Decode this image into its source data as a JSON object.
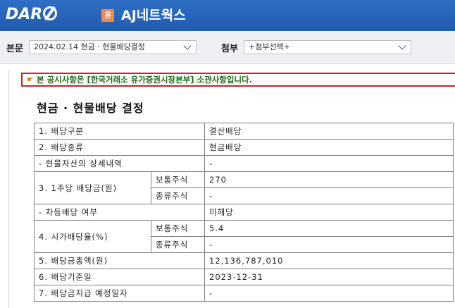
{
  "header": {
    "logo": "DART",
    "badge": "유",
    "company": "AJ네트웍스"
  },
  "toolbar": {
    "main_label": "본문",
    "main_select": "2024.02.14  현금 · 현물배당결정",
    "attach_label": "첨부",
    "attach_select": "+첨부선택+"
  },
  "notice": "본 공시사항은 [한국거래소 유가증권시장본부] 소관사항입니다.",
  "doc_title": "현금 · 현물배당 결정",
  "rows": [
    {
      "label": "1. 배당구분",
      "value": "결산배당"
    },
    {
      "label": "2. 배당종류",
      "value": "현금배당"
    },
    {
      "label": "- 현물자산의 상세내역",
      "value": "-"
    },
    {
      "label": "3. 1주당 배당금(원)",
      "sub1": "보통주식",
      "val1": "270",
      "sub2": "종류주식",
      "val2": "-"
    },
    {
      "label": "- 차등배당 여부",
      "value": "미해당"
    },
    {
      "label": "4. 시가배당율(%)",
      "sub1": "보통주식",
      "val1": "5.4",
      "sub2": "종류주식",
      "val2": "-"
    },
    {
      "label": "5. 배당금총액(원)",
      "value": "12,136,787,010"
    },
    {
      "label": "6. 배당기준일",
      "value": "2023-12-31"
    },
    {
      "label": "7. 배당금지급 예정일자",
      "value": "-"
    }
  ]
}
